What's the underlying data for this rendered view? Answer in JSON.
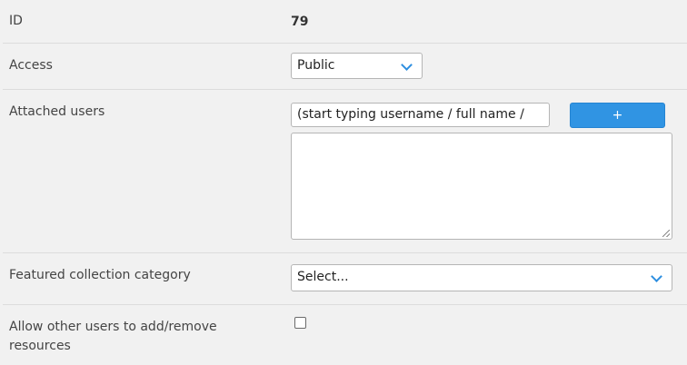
{
  "fields": {
    "id": {
      "label": "ID",
      "value": "79"
    },
    "access": {
      "label": "Access",
      "selected": "Public"
    },
    "attached_users": {
      "label": "Attached users",
      "search_value": "(start typing username / full name /",
      "add_button": "+",
      "list_value": ""
    },
    "featured_category": {
      "label": "Featured collection category",
      "selected": "Select..."
    },
    "allow_users": {
      "label": "Allow other users to add/remove resources",
      "checked": false
    }
  },
  "colors": {
    "accent": "#3094e3",
    "background": "#f1f1f1",
    "divider": "#dcdcdc"
  },
  "icons": {
    "dropdown": "chevron-down-icon",
    "resize": "resize-grip-icon"
  }
}
